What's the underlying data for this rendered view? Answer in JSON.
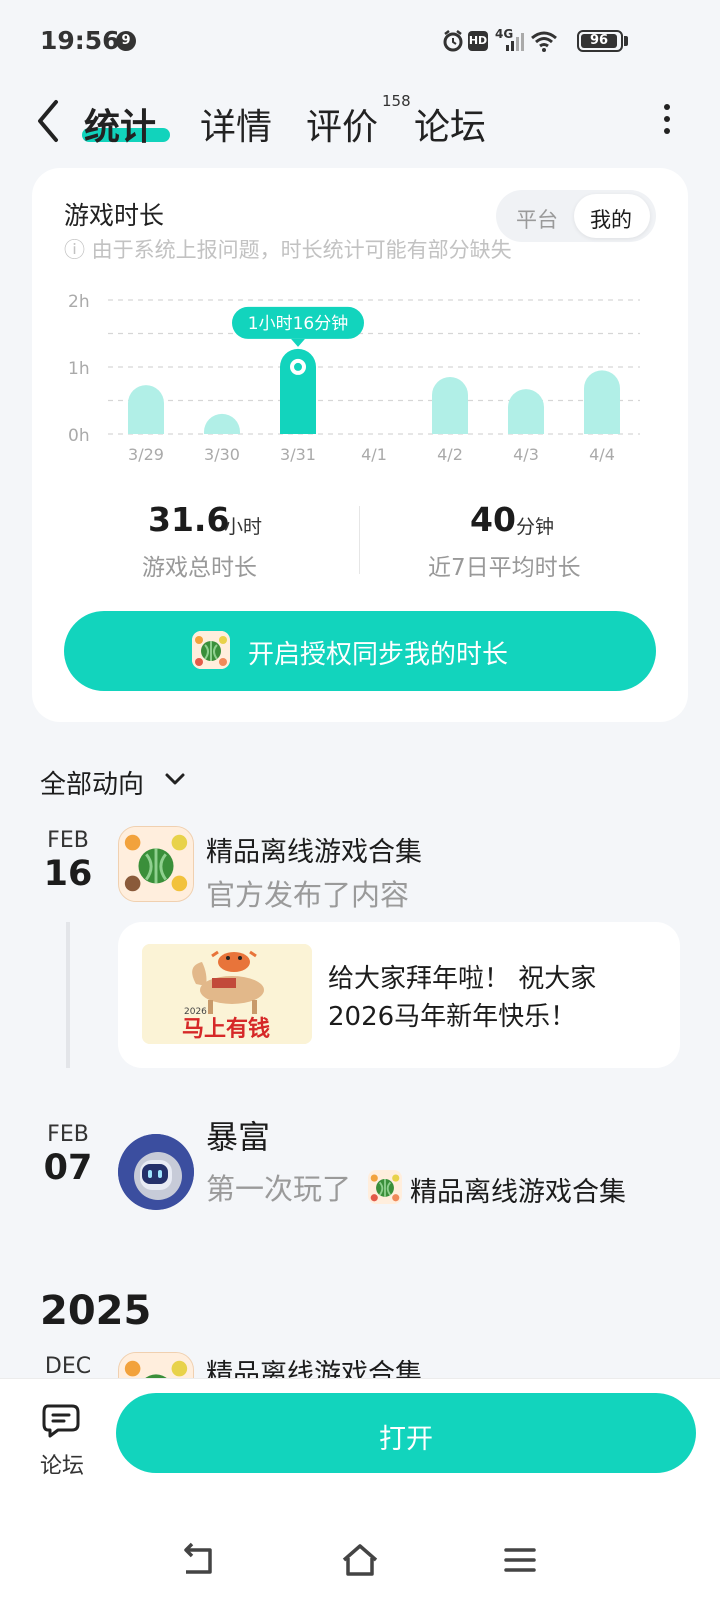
{
  "status_bar": {
    "time": "19:56",
    "notif_badge": "9",
    "network": "4G",
    "hd": "HD",
    "battery": "96",
    "battery_level": 0.96
  },
  "nav": {
    "tabs": [
      {
        "label": "统计",
        "active": true
      },
      {
        "label": "详情",
        "active": false
      },
      {
        "label": "评价",
        "active": false,
        "count": "158"
      },
      {
        "label": "论坛",
        "active": false
      }
    ]
  },
  "playtime": {
    "title": "游戏时长",
    "note": "ⓘ 由于系统上报问题，时长统计可能有部分缺失",
    "toggle": [
      "平台",
      "我的"
    ],
    "toggle_selected": "我的",
    "total_value": "31.6",
    "total_unit": "小时",
    "total_label": "游戏总时长",
    "avg_value": "40",
    "avg_unit": "分钟",
    "avg_label": "近7日平均时长",
    "sync_button": "开启授权同步我的时长"
  },
  "chart_data": {
    "type": "bar",
    "categories": [
      "3/29",
      "3/30",
      "3/31",
      "4/1",
      "4/2",
      "4/3",
      "4/4"
    ],
    "values": [
      0.73,
      0.3,
      1.27,
      0,
      0.85,
      0.67,
      0.95
    ],
    "y_ticks": [
      "0h",
      "1h",
      "2h"
    ],
    "ylim": [
      0,
      2
    ],
    "highlight_index": 2,
    "highlight_label": "1小时16分钟",
    "grid": true,
    "colors": {
      "bar": "#b1efe7",
      "highlight": "#12d4bd",
      "grid": "#d6d6d6",
      "tick": "#aaaaaa"
    }
  },
  "feed": {
    "filter_label": "全部动向",
    "items": [
      {
        "month": "FEB",
        "day": "16",
        "title": "精品离线游戏合集",
        "subtitle": "官方发布了内容",
        "post_text": "给大家拜年啦！ 祝大家2026马年新年快乐！",
        "post_image_text": "马上有钱",
        "post_image_year": "2026"
      },
      {
        "month": "FEB",
        "day": "07",
        "title": "暴富",
        "subtitle_prefix": "第一次玩了",
        "subtitle_game": "精品离线游戏合集"
      }
    ],
    "year_heading": "2025",
    "next_item": {
      "month": "DEC",
      "title": "精品离线游戏合集"
    }
  },
  "bottom_bar": {
    "forum_label": "论坛",
    "open_button": "打开"
  },
  "colors": {
    "accent": "#12d4bd",
    "background": "#f4f6f9"
  }
}
